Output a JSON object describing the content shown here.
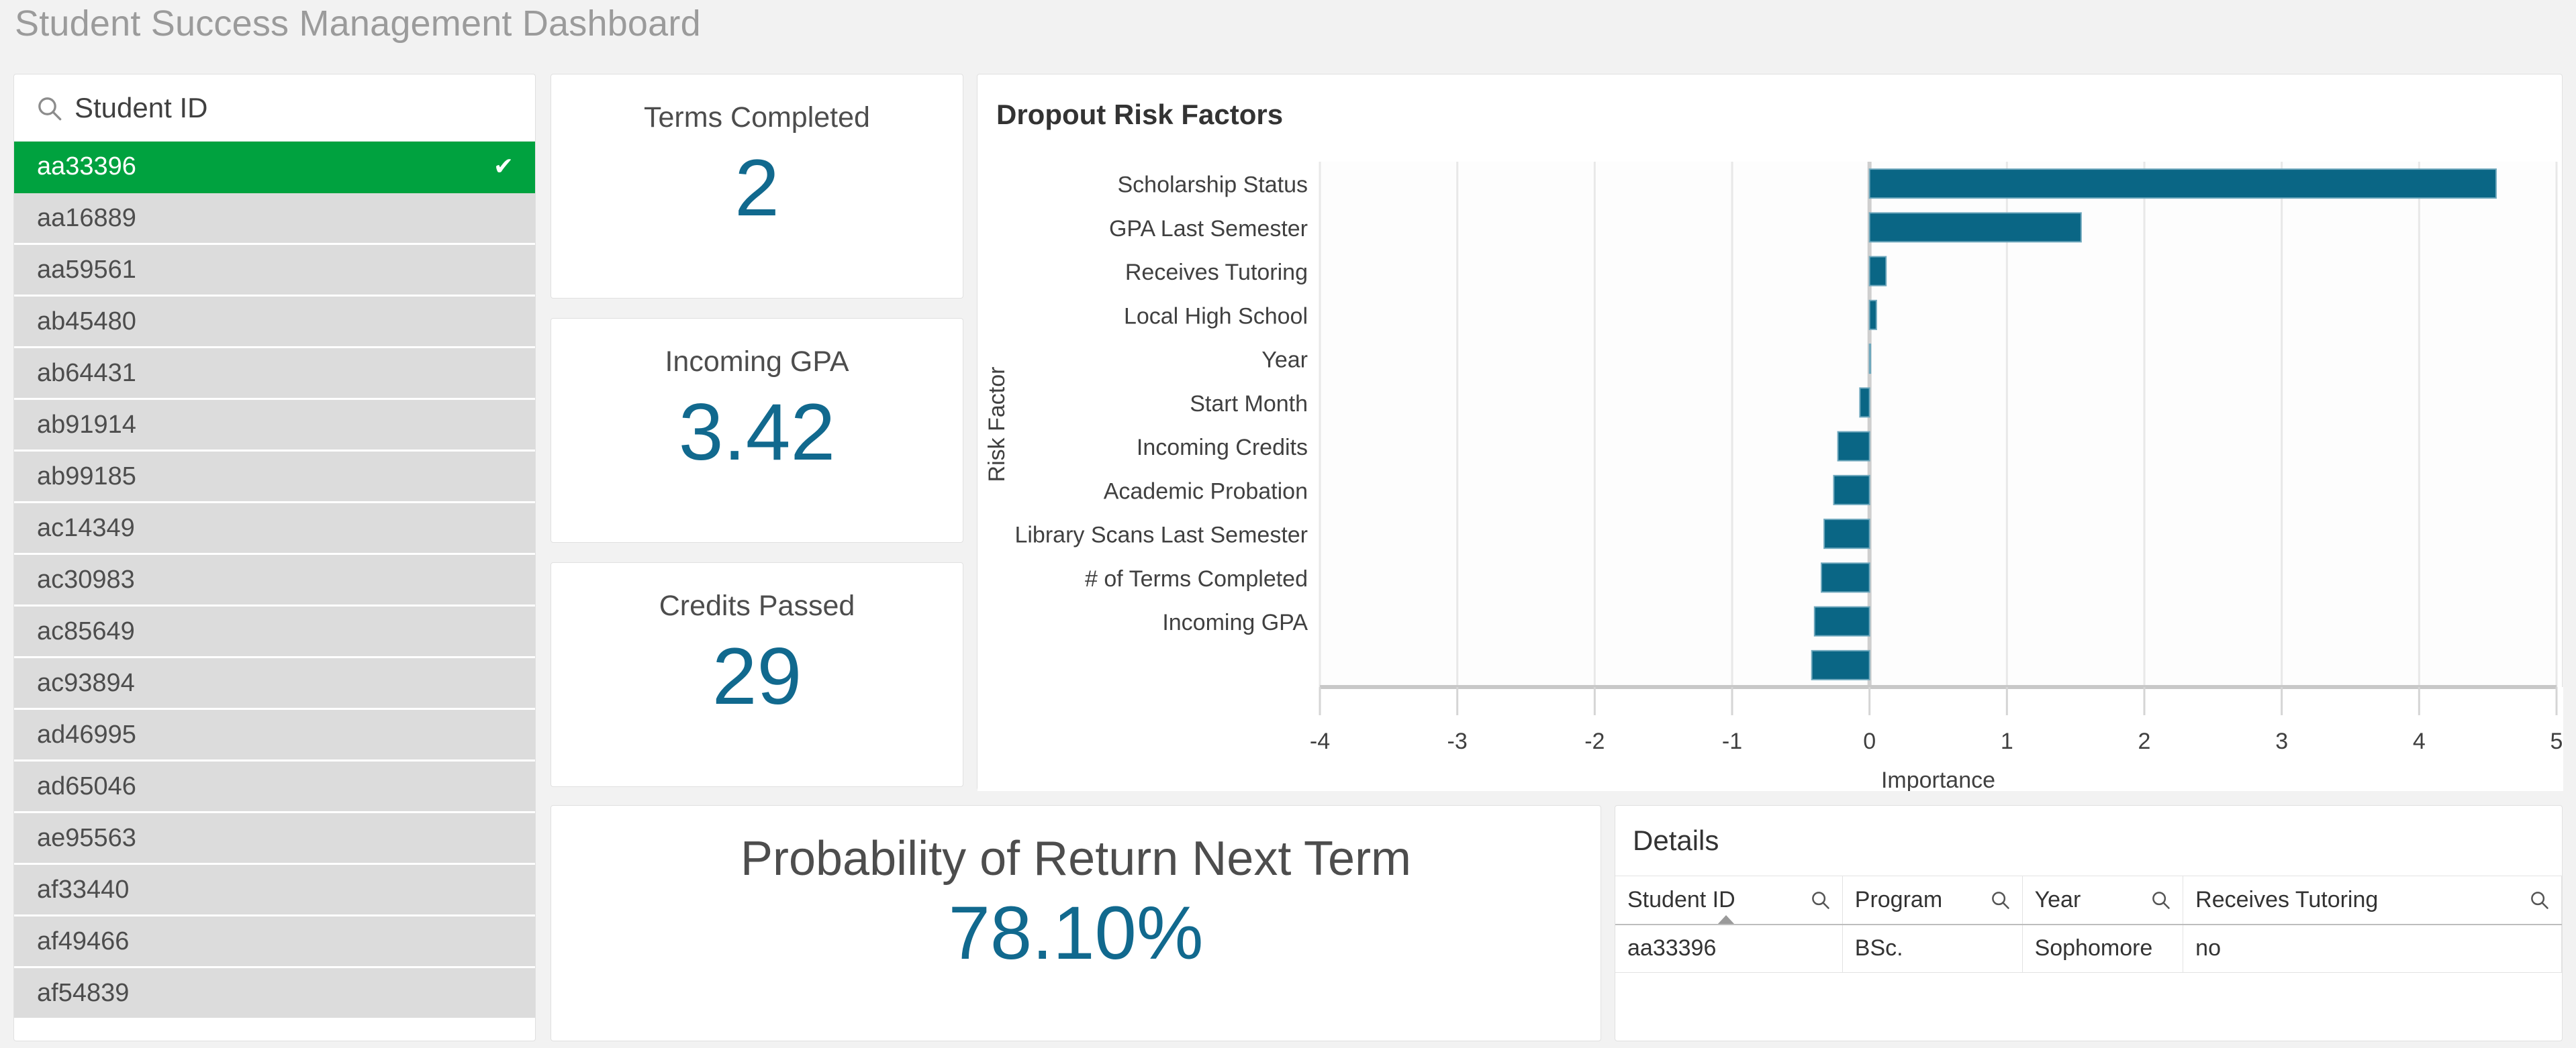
{
  "header": {
    "title": "Student Success Management Dashboard"
  },
  "selector": {
    "search_placeholder": "Student ID",
    "search_icon": "search-icon",
    "check_glyph": "✔",
    "selected_id": "aa33396",
    "items": [
      {
        "id": "aa33396",
        "selected": true
      },
      {
        "id": "aa16889",
        "selected": false
      },
      {
        "id": "aa59561",
        "selected": false
      },
      {
        "id": "ab45480",
        "selected": false
      },
      {
        "id": "ab64431",
        "selected": false
      },
      {
        "id": "ab91914",
        "selected": false
      },
      {
        "id": "ab99185",
        "selected": false
      },
      {
        "id": "ac14349",
        "selected": false
      },
      {
        "id": "ac30983",
        "selected": false
      },
      {
        "id": "ac85649",
        "selected": false
      },
      {
        "id": "ac93894",
        "selected": false
      },
      {
        "id": "ad46995",
        "selected": false
      },
      {
        "id": "ad65046",
        "selected": false
      },
      {
        "id": "ae95563",
        "selected": false
      },
      {
        "id": "af33440",
        "selected": false
      },
      {
        "id": "af49466",
        "selected": false
      },
      {
        "id": "af54839",
        "selected": false
      }
    ]
  },
  "kpis": {
    "terms_completed": {
      "title": "Terms Completed",
      "value": "2"
    },
    "incoming_gpa": {
      "title": "Incoming GPA",
      "value": "3.42"
    },
    "credits_passed": {
      "title": "Credits Passed",
      "value": "29"
    }
  },
  "probability": {
    "title": "Probability of Return Next Term",
    "value": "78.10%"
  },
  "details": {
    "title": "Details",
    "search_icon": "search-icon",
    "sort_column": "Student ID",
    "sort_direction": "ascending",
    "columns": [
      "Student ID",
      "Program",
      "Year",
      "Receives Tutoring"
    ],
    "rows": [
      [
        "aa33396",
        "BSc.",
        "Sophomore",
        "no"
      ]
    ]
  },
  "colors": {
    "accent_teal": "#11698e",
    "bar_teal": "#0a6685",
    "selection_green": "#00a23f",
    "page_background": "#f2f2f2",
    "card_background": "#ffffff",
    "title_grey": "#9b9b9b"
  },
  "chart_data": {
    "type": "bar",
    "orientation": "horizontal",
    "title": "Dropout Risk Factors",
    "xlabel": "Importance",
    "ylabel": "Risk Factor",
    "xlim": [
      -4,
      5
    ],
    "xticks": [
      -4,
      -3,
      -2,
      -1,
      0,
      1,
      2,
      3,
      4,
      5
    ],
    "grid": true,
    "legend": "none",
    "bar_color": "#0a6685",
    "categories": [
      "Scholarship Status",
      "GPA Last Semester",
      "Receives Tutoring",
      "Local High School",
      "Year",
      "Start Month",
      "Incoming Credits",
      "Academic Probation",
      "Library Scans Last Semester",
      "# of Terms Completed",
      "Incoming GPA",
      ""
    ],
    "values": [
      4.56,
      1.54,
      0.12,
      0.05,
      0.0,
      -0.07,
      -0.23,
      -0.26,
      -0.33,
      -0.35,
      -0.4,
      -0.42
    ],
    "notes": "Last bar is clipped at the bottom edge of the plot area and has no visible category label."
  }
}
